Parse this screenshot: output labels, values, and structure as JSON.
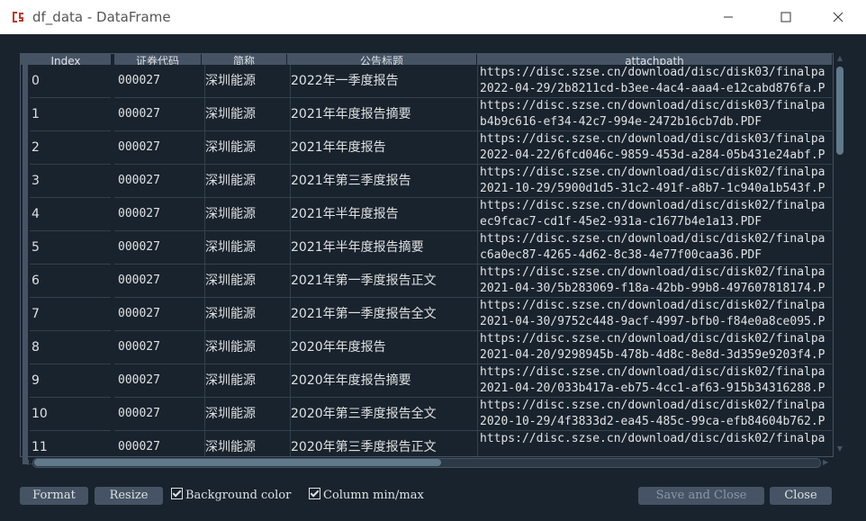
{
  "window": {
    "title": "df_data - DataFrame",
    "min_symbol": "—",
    "max_symbol": "☐",
    "close_symbol": "✕"
  },
  "table": {
    "headers": {
      "index": "Index",
      "code": "证券代码",
      "name": "简称",
      "title": "公告标题",
      "path": "attachpath"
    },
    "rows": [
      {
        "index": "0",
        "code": "000027",
        "name": "深圳能源",
        "title": "2022年一季度报告",
        "path1": "https://disc.szse.cn/download/disc/disk03/finalpa",
        "path2": "2022-04-29/2b8211cd-b3ee-4ac4-aaa4-e12cabd876fa.P"
      },
      {
        "index": "1",
        "code": "000027",
        "name": "深圳能源",
        "title": "2021年年度报告摘要",
        "path1": "https://disc.szse.cn/download/disc/disk03/finalpa",
        "path2": "b4b9c616-ef34-42c7-994e-2472b16cb7db.PDF"
      },
      {
        "index": "2",
        "code": "000027",
        "name": "深圳能源",
        "title": "2021年年度报告",
        "path1": "https://disc.szse.cn/download/disc/disk03/finalpa",
        "path2": "2022-04-22/6fcd046c-9859-453d-a284-05b431e24abf.P"
      },
      {
        "index": "3",
        "code": "000027",
        "name": "深圳能源",
        "title": "2021年第三季度报告",
        "path1": "https://disc.szse.cn/download/disc/disk02/finalpa",
        "path2": "2021-10-29/5900d1d5-31c2-491f-a8b7-1c940a1b543f.P"
      },
      {
        "index": "4",
        "code": "000027",
        "name": "深圳能源",
        "title": "2021年半年度报告",
        "path1": "https://disc.szse.cn/download/disc/disk02/finalpa",
        "path2": "ec9fcac7-cd1f-45e2-931a-c1677b4e1a13.PDF"
      },
      {
        "index": "5",
        "code": "000027",
        "name": "深圳能源",
        "title": "2021年半年度报告摘要",
        "path1": "https://disc.szse.cn/download/disc/disk02/finalpa",
        "path2": "c6a0ec87-4265-4d62-8c38-4e77f00caa36.PDF"
      },
      {
        "index": "6",
        "code": "000027",
        "name": "深圳能源",
        "title": "2021年第一季度报告正文",
        "path1": "https://disc.szse.cn/download/disc/disk02/finalpa",
        "path2": "2021-04-30/5b283069-f18a-42bb-99b8-497607818174.P"
      },
      {
        "index": "7",
        "code": "000027",
        "name": "深圳能源",
        "title": "2021年第一季度报告全文",
        "path1": "https://disc.szse.cn/download/disc/disk02/finalpa",
        "path2": "2021-04-30/9752c448-9acf-4997-bfb0-f84e0a8ce095.P"
      },
      {
        "index": "8",
        "code": "000027",
        "name": "深圳能源",
        "title": "2020年年度报告",
        "path1": "https://disc.szse.cn/download/disc/disk02/finalpa",
        "path2": "2021-04-20/9298945b-478b-4d8c-8e8d-3d359e9203f4.P"
      },
      {
        "index": "9",
        "code": "000027",
        "name": "深圳能源",
        "title": "2020年年度报告摘要",
        "path1": "https://disc.szse.cn/download/disc/disk02/finalpa",
        "path2": "2021-04-20/033b417a-eb75-4cc1-af63-915b34316288.P"
      },
      {
        "index": "10",
        "code": "000027",
        "name": "深圳能源",
        "title": "2020年第三季度报告全文",
        "path1": "https://disc.szse.cn/download/disc/disk02/finalpa",
        "path2": "2020-10-29/4f3833d2-ea45-485c-99ca-efb84604b762.P"
      },
      {
        "index": "11",
        "code": "000027",
        "name": "深圳能源",
        "title": "2020年第三季度报告正文",
        "path1": "https://disc.szse.cn/download/disc/disk02/finalpa",
        "path2": ""
      }
    ]
  },
  "footer": {
    "format_label": "Format",
    "resize_label": "Resize",
    "bg_color_label": "Background color",
    "col_minmax_label": "Column min/max",
    "save_close_label": "Save and Close",
    "close_label": "Close"
  }
}
